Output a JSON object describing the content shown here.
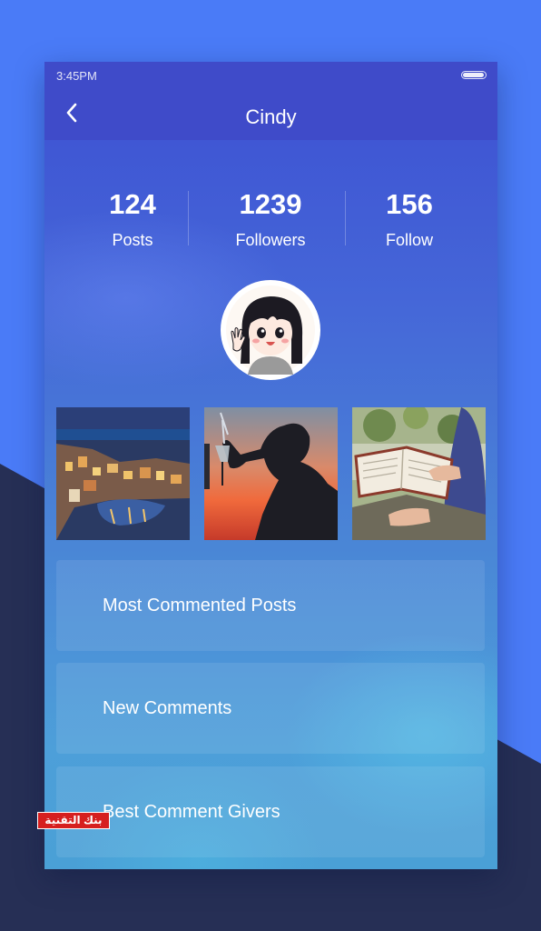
{
  "status_bar": {
    "time": "3:45PM",
    "battery_level": 0.9
  },
  "header": {
    "title": "Cindy",
    "back_icon": "chevron-left-icon"
  },
  "stats": [
    {
      "value": "124",
      "label": "Posts"
    },
    {
      "value": "1239",
      "label": "Followers"
    },
    {
      "value": "156",
      "label": "Follow"
    }
  ],
  "avatar": {
    "icon": "cartoon-girl-avatar"
  },
  "photos": [
    {
      "subject": "coastal-village-night"
    },
    {
      "subject": "silhouette-toast-sunset"
    },
    {
      "subject": "reading-book"
    }
  ],
  "menu": [
    {
      "label": "Most Commented Posts"
    },
    {
      "label": "New Comments"
    },
    {
      "label": "Best Comment Givers"
    }
  ],
  "watermark": {
    "text": "بنك التقنية"
  },
  "colors": {
    "background": "#4a7bf7",
    "dark_band": "#262f55",
    "header_bar": "#3f4bc9",
    "watermark_red": "#d61f1f"
  }
}
